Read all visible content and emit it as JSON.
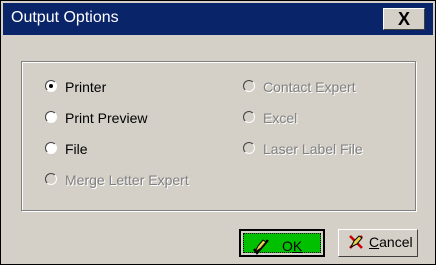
{
  "window": {
    "title": "Output Options",
    "close_label": "X"
  },
  "options": [
    {
      "label": "Printer",
      "selected": true,
      "enabled": true
    },
    {
      "label": "Print Preview",
      "selected": false,
      "enabled": true
    },
    {
      "label": "File",
      "selected": false,
      "enabled": true
    },
    {
      "label": "Merge Letter Expert",
      "selected": false,
      "enabled": false
    },
    {
      "label": "Contact Expert",
      "selected": false,
      "enabled": false
    },
    {
      "label": "Excel",
      "selected": false,
      "enabled": false
    },
    {
      "label": "Laser Label File",
      "selected": false,
      "enabled": false
    }
  ],
  "buttons": {
    "ok": {
      "pre": "O",
      "underline": "K",
      "post": "",
      "icon": "pencil-check-icon",
      "accent": "#00c000"
    },
    "cancel": {
      "pre": "",
      "underline": "C",
      "post": "ancel",
      "icon": "pencil-x-icon"
    }
  }
}
